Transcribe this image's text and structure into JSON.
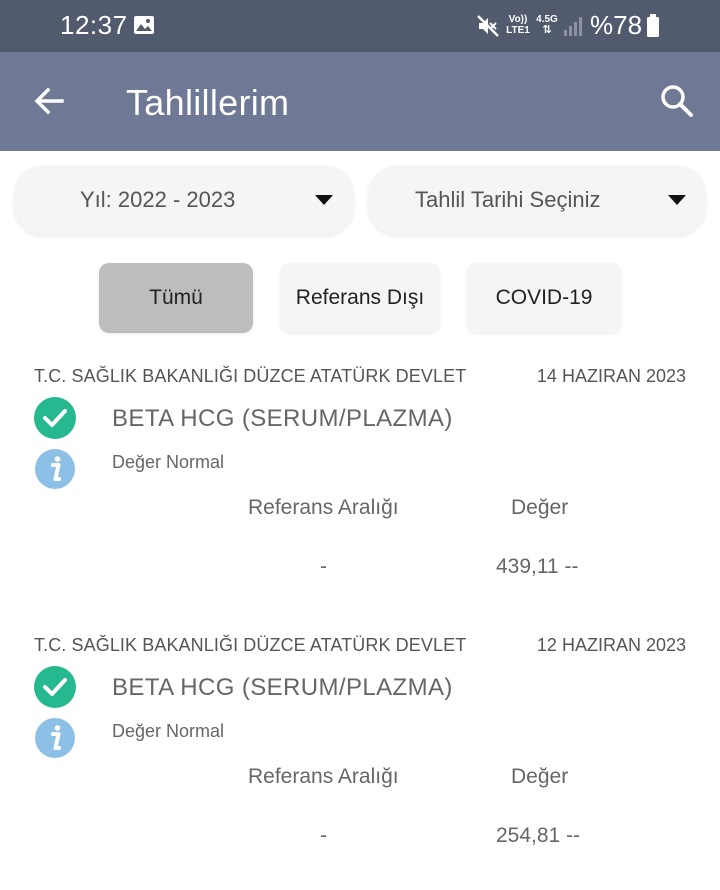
{
  "status_bar": {
    "time": "12:37",
    "volte": "Vo)) LTE1",
    "network": "4.5G",
    "battery": "%78"
  },
  "app_bar": {
    "title": "Tahlillerim"
  },
  "filters": {
    "year": "Yıl: 2022 - 2023",
    "date": "Tahlil Tarihi Seçiniz",
    "buttons": [
      "Tümü",
      "Referans Dışı",
      "COVID-19"
    ],
    "active": "Tümü"
  },
  "results": [
    {
      "institution": "T.C. SAĞLIK BAKANLIĞI DÜZCE ATATÜRK DEVLET",
      "date": "14 HAZIRAN 2023",
      "test": "BETA HCG (SERUM/PLAZMA)",
      "status": "Değer Normal",
      "ref_header": "Referans Aralığı",
      "val_header": "Değer",
      "ref_value": "-",
      "value": "439,11 --"
    },
    {
      "institution": "T.C. SAĞLIK BAKANLIĞI DÜZCE ATATÜRK DEVLET",
      "date": "12 HAZIRAN 2023",
      "test": "BETA HCG (SERUM/PLAZMA)",
      "status": "Değer Normal",
      "ref_header": "Referans Aralığı",
      "val_header": "Değer",
      "ref_value": "-",
      "value": "254,81 --"
    }
  ],
  "colors": {
    "status_bar": "#525a6d",
    "app_bar": "#6f7894",
    "check": "#26b88e",
    "info": "#8dc0e6"
  },
  "icons": [
    "gallery-icon",
    "mute-icon",
    "signal-icon",
    "battery-icon",
    "back-arrow-icon",
    "search-icon",
    "caret-down-icon",
    "check-circle-icon",
    "info-icon"
  ]
}
